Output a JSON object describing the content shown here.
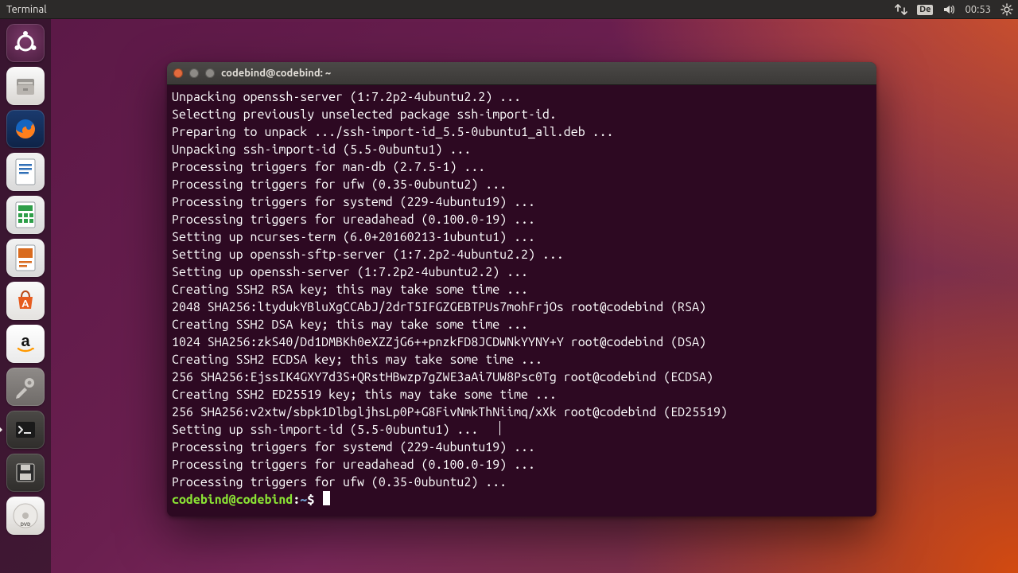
{
  "menubar": {
    "app_title": "Terminal",
    "keyboard_indicator": "De",
    "clock": "00:53"
  },
  "launcher": {
    "items": [
      {
        "name": "dash",
        "label": "Dash"
      },
      {
        "name": "files",
        "label": "Files"
      },
      {
        "name": "firefox",
        "label": "Firefox"
      },
      {
        "name": "writer",
        "label": "LibreOffice Writer"
      },
      {
        "name": "calc",
        "label": "LibreOffice Calc"
      },
      {
        "name": "impress",
        "label": "LibreOffice Impress"
      },
      {
        "name": "software",
        "label": "Ubuntu Software"
      },
      {
        "name": "amazon",
        "label": "Amazon"
      },
      {
        "name": "settings",
        "label": "System Settings"
      },
      {
        "name": "terminal",
        "label": "Terminal"
      },
      {
        "name": "save",
        "label": "Save"
      },
      {
        "name": "dvd",
        "label": "Disc"
      }
    ]
  },
  "terminal": {
    "title": "codebind@codebind: ~",
    "prompt": {
      "userhost": "codebind@codebind",
      "sep": ":",
      "path": "~",
      "symbol": "$"
    },
    "lines": [
      "Unpacking openssh-server (1:7.2p2-4ubuntu2.2) ...",
      "Selecting previously unselected package ssh-import-id.",
      "Preparing to unpack .../ssh-import-id_5.5-0ubuntu1_all.deb ...",
      "Unpacking ssh-import-id (5.5-0ubuntu1) ...",
      "Processing triggers for man-db (2.7.5-1) ...",
      "Processing triggers for ufw (0.35-0ubuntu2) ...",
      "Processing triggers for systemd (229-4ubuntu19) ...",
      "Processing triggers for ureadahead (0.100.0-19) ...",
      "Setting up ncurses-term (6.0+20160213-1ubuntu1) ...",
      "Setting up openssh-sftp-server (1:7.2p2-4ubuntu2.2) ...",
      "Setting up openssh-server (1:7.2p2-4ubuntu2.2) ...",
      "Creating SSH2 RSA key; this may take some time ...",
      "2048 SHA256:ltydukYBluXgCCAbJ/2drT5IFGZGEBTPUs7mohFrjOs root@codebind (RSA)",
      "Creating SSH2 DSA key; this may take some time ...",
      "1024 SHA256:zkS40/Dd1DMBKh0eXZZjG6++pnzkFD8JCDWNkYYNY+Y root@codebind (DSA)",
      "Creating SSH2 ECDSA key; this may take some time ...",
      "256 SHA256:EjssIK4GXY7d3S+QRstHBwzp7gZWE3aAi7UW8Psc0Tg root@codebind (ECDSA)",
      "Creating SSH2 ED25519 key; this may take some time ...",
      "256 SHA256:v2xtw/sbpk1DlbgljhsLp0P+G8FivNmkThNiimq/xXk root@codebind (ED25519)",
      "Setting up ssh-import-id (5.5-0ubuntu1) ...",
      "Processing triggers for systemd (229-4ubuntu19) ...",
      "Processing triggers for ureadahead (0.100.0-19) ...",
      "Processing triggers for ufw (0.35-0ubuntu2) ..."
    ]
  }
}
